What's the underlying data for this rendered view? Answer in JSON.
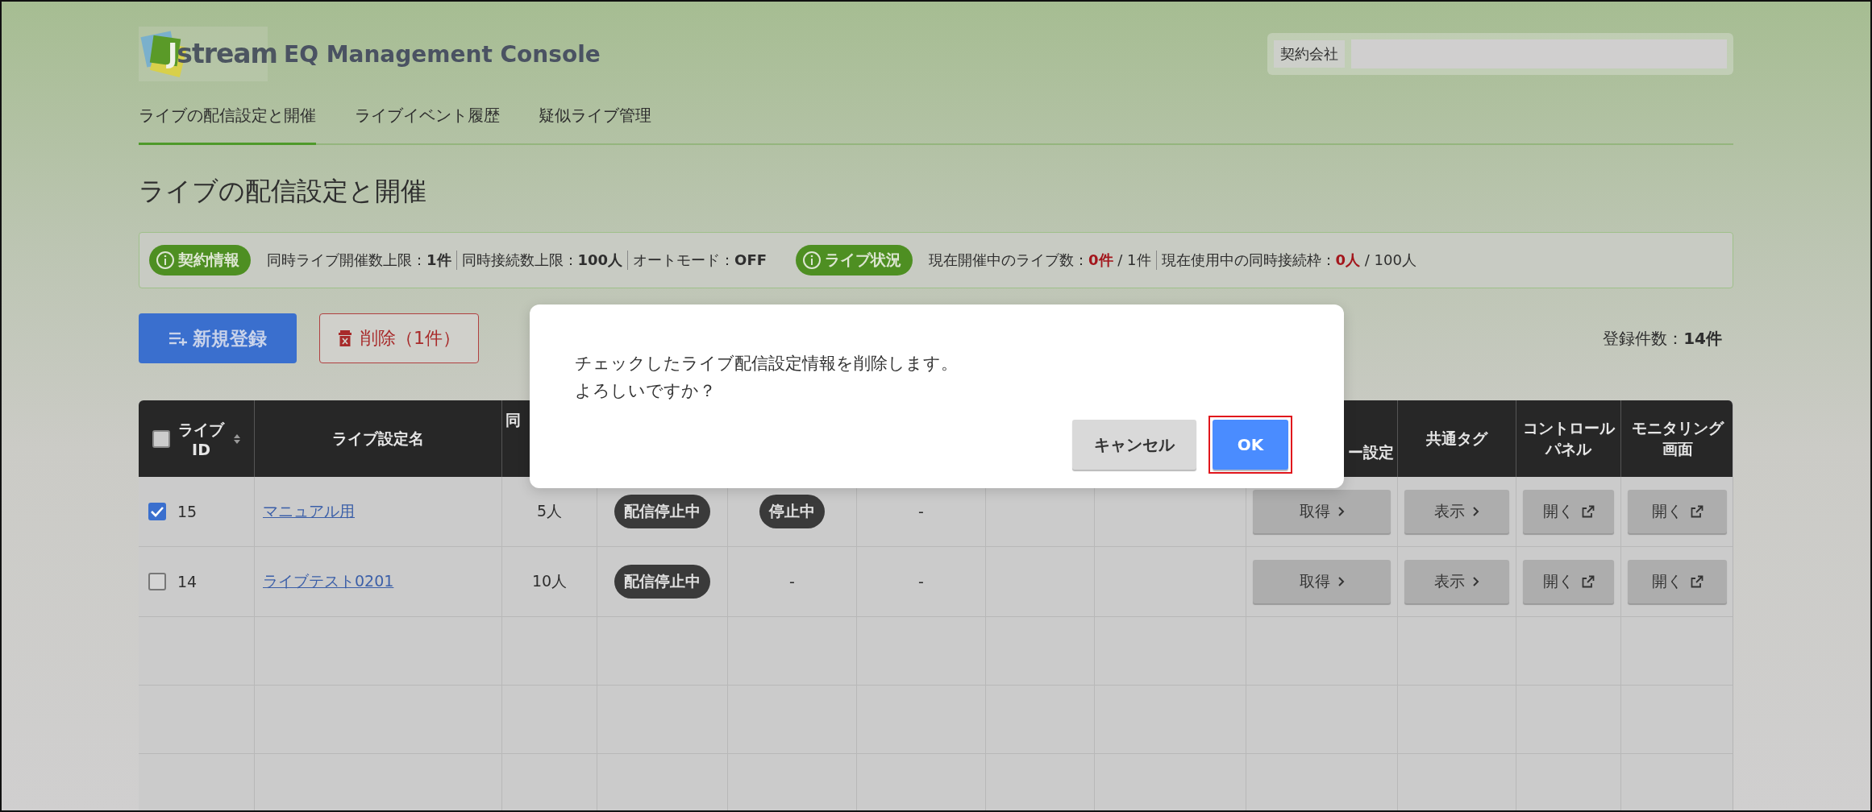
{
  "header": {
    "logo": {
      "mark": "J",
      "text": "stream"
    },
    "title": "EQ Management Console",
    "company_label": "契約会社"
  },
  "tabs": [
    {
      "label": "ライブの配信設定と開催",
      "selected": true
    },
    {
      "label": "ライブイベント履歴",
      "selected": false
    },
    {
      "label": "疑似ライブ管理",
      "selected": false
    }
  ],
  "page_title": "ライブの配信設定と開催",
  "info_groups": [
    {
      "badge": "契約情報",
      "items": [
        {
          "label": "同時ライブ開催数上限：",
          "value": "1件",
          "alert": false
        },
        {
          "label": "同時接続数上限：",
          "value": "100人",
          "alert": false
        },
        {
          "label": "オートモード：",
          "value": "OFF",
          "alert": false
        }
      ]
    },
    {
      "badge": "ライブ状況",
      "items": [
        {
          "label": "現在開催中のライブ数：",
          "value": "0件",
          "rest": " / 1件",
          "alert": true
        },
        {
          "label": "現在使用中の同時接続枠：",
          "value": "0人",
          "rest": " / 100人",
          "alert": true
        }
      ]
    }
  ],
  "toolbar": {
    "new_button": "新規登録",
    "delete_button": "削除（1件）",
    "count_label": "登録件数：",
    "count": "14件"
  },
  "table": {
    "all_checked": false,
    "columns": [
      {
        "label": "ライブID",
        "sortable": true
      },
      {
        "label": "ライブ設定名"
      },
      {
        "label": "同"
      },
      {},
      {},
      {},
      {},
      {},
      {
        "label": "ー設定"
      },
      {
        "label": "共通タグ"
      },
      {
        "label": "コントロールパネル"
      },
      {
        "label": "モニタリング画面"
      }
    ],
    "rows": [
      {
        "selected": true,
        "cells": [
          {
            "kind": "id",
            "text": "15"
          },
          {
            "kind": "link",
            "text": "マニュアル用"
          },
          {
            "kind": "text",
            "text": "5人"
          },
          {
            "kind": "chip",
            "text": "配信停止中"
          },
          {
            "kind": "chip",
            "text": "停止中"
          },
          {
            "kind": "text",
            "text": "-"
          },
          {
            "kind": "empty"
          },
          {
            "kind": "empty"
          },
          {
            "kind": "next",
            "text": "取得"
          },
          {
            "kind": "next",
            "text": "表示"
          },
          {
            "kind": "open",
            "text": "開く"
          },
          {
            "kind": "open",
            "text": "開く"
          }
        ]
      },
      {
        "selected": false,
        "cells": [
          {
            "kind": "id",
            "text": "14"
          },
          {
            "kind": "link",
            "text": "ライブテスト0201"
          },
          {
            "kind": "text",
            "text": "10人"
          },
          {
            "kind": "chip",
            "text": "配信停止中"
          },
          {
            "kind": "text",
            "text": "-"
          },
          {
            "kind": "text",
            "text": "-"
          },
          {
            "kind": "empty"
          },
          {
            "kind": "empty"
          },
          {
            "kind": "next",
            "text": "取得"
          },
          {
            "kind": "next",
            "text": "表示"
          },
          {
            "kind": "open",
            "text": "開く"
          },
          {
            "kind": "open",
            "text": "開く"
          }
        ]
      }
    ]
  },
  "dialog": {
    "message_lines": [
      "チェックしたライブ配信設定情報を削除します。",
      "よろしいですか？"
    ],
    "buttons": [
      {
        "label": "キャンセル",
        "kind": "secondary",
        "focused": false
      },
      {
        "label": "OK",
        "kind": "primary",
        "focused": true
      }
    ]
  }
}
